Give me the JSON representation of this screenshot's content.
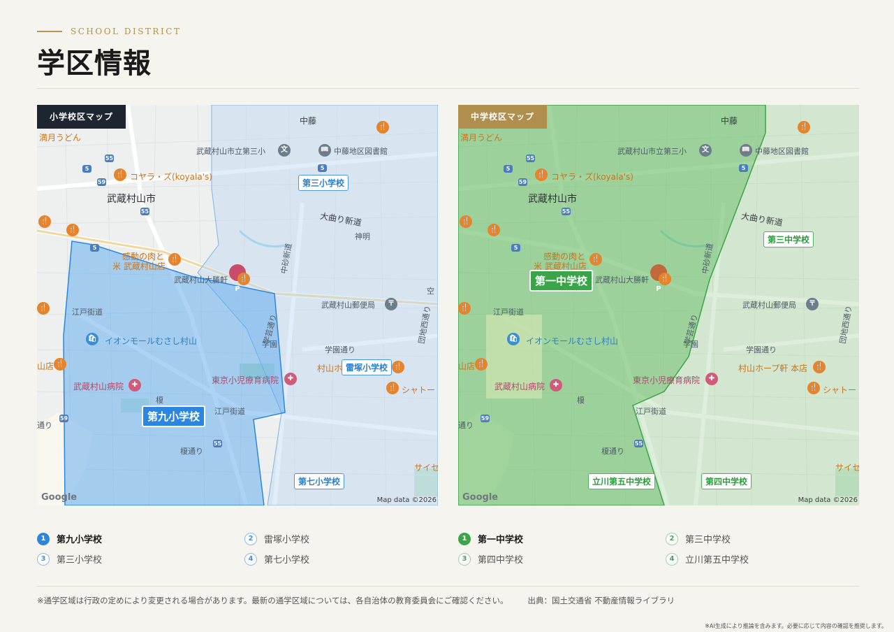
{
  "header": {
    "eyebrow": "SCHOOL DISTRICT",
    "title": "学区情報"
  },
  "colors": {
    "accent_gold": "#b08f4e",
    "elementary_blue": "#2a86e0",
    "junior_green": "#3aa548"
  },
  "maps": {
    "elementary": {
      "tag": "小学校区マップ",
      "highlighted_school": "第九小学校",
      "school_labels": [
        "第三小学校",
        "雷塚小学校",
        "第七小学校"
      ],
      "attribution": "Map data ©2026",
      "logo": "Google"
    },
    "junior": {
      "tag": "中学校区マップ",
      "highlighted_school": "第一中学校",
      "school_labels": [
        "第三中学校",
        "立川第五中学校",
        "第四中学校"
      ],
      "attribution": "Map data ©2026",
      "logo": "Google"
    },
    "place_labels": {
      "nakafuji": "中藤",
      "udon": "満月うどん",
      "koyalas": "コヤラ・ズ(koyala's)",
      "city": "武蔵村山市",
      "school3": "武蔵村山市立第三小",
      "library": "中藤地区図書館",
      "omagari": "大曲り新道",
      "shinmei": "神明",
      "meat1": "感動の肉と",
      "meat2": "米 武蔵村山店",
      "taishoken": "武蔵村山大勝軒",
      "postoffice": "武蔵村山郵便局",
      "edo": "江戸街道",
      "edo2": "江戸街道",
      "gakuen": "学園",
      "gakuendori": "学園通り",
      "aeon": "イオンモールむさし村山",
      "hospital": "武蔵村山病院",
      "childhosp": "東京小児療育病院",
      "hope": "村山ホープ軒 本店",
      "hope_short": "村山ホ",
      "chateau": "シャトー",
      "enoki": "榎",
      "enokidori": "榎通り",
      "nakasuna": "中砂新道",
      "danchi": "団地西通り",
      "gakushu": "学芸通り",
      "sora": "空",
      "saisei": "サイセ",
      "mise": "山店",
      "dori": "通り"
    },
    "routes": {
      "r55": "55",
      "r5": "5",
      "r59": "59"
    },
    "poi_glyphs": {
      "food": "🍴",
      "school": "文",
      "library": "📖",
      "post": "〒",
      "shop": "🛍",
      "hospital": "✚",
      "parking": "P"
    }
  },
  "legend": {
    "elementary": [
      {
        "num": "1",
        "name": "第九小学校"
      },
      {
        "num": "2",
        "name": "雷塚小学校"
      },
      {
        "num": "3",
        "name": "第三小学校"
      },
      {
        "num": "4",
        "name": "第七小学校"
      }
    ],
    "junior": [
      {
        "num": "1",
        "name": "第一中学校"
      },
      {
        "num": "2",
        "name": "第三中学校"
      },
      {
        "num": "3",
        "name": "第四中学校"
      },
      {
        "num": "4",
        "name": "立川第五中学校"
      }
    ]
  },
  "footer": {
    "note": "※通学区域は行政の定めにより変更される場合があります。最新の通学区域については、各自治体の教育委員会にご確認ください。",
    "source": "出典：国土交通省 不動産情報ライブラリ",
    "ai_note": "※AI生成により推論を含みます。必要に応じて内容の確認を推奨します。"
  }
}
